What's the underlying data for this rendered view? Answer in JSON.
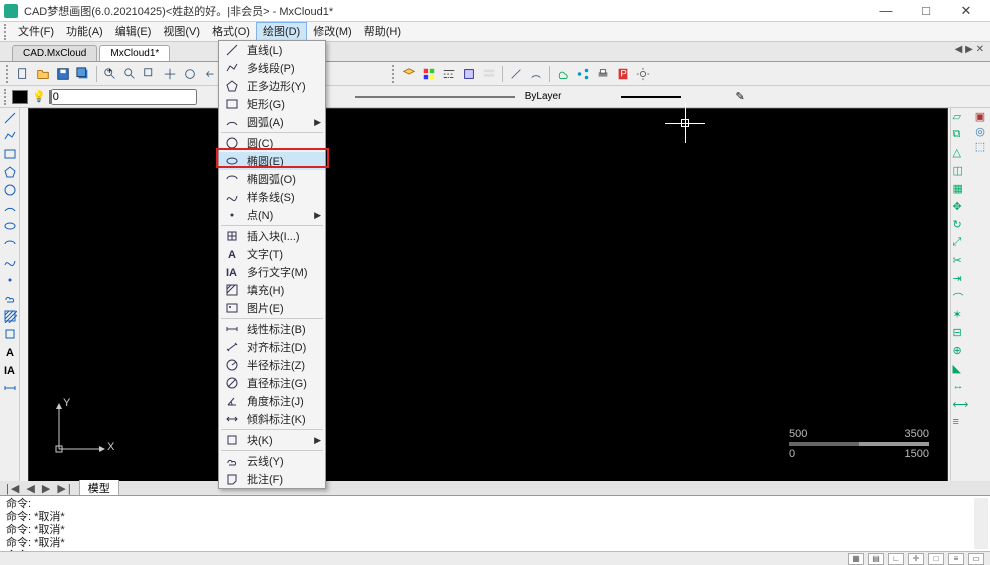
{
  "title": "CAD梦想画图(6.0.20210425)<姓赵的好。|非会员> - MxCloud1*",
  "menus": [
    "文件(F)",
    "功能(A)",
    "编辑(E)",
    "视图(V)",
    "格式(O)",
    "绘图(D)",
    "修改(M)",
    "帮助(H)"
  ],
  "active_menu_index": 5,
  "doctabs": {
    "tabs": [
      "CAD.MxCloud",
      "MxCloud1*"
    ],
    "active": 1
  },
  "layer": {
    "name": "0"
  },
  "prop": {
    "linetype": "ByLayer"
  },
  "draw_menu": [
    {
      "label": "直线(L)",
      "icon": "line"
    },
    {
      "label": "多线段(P)",
      "icon": "polyline"
    },
    {
      "label": "正多边形(Y)",
      "icon": "polygon"
    },
    {
      "label": "矩形(G)",
      "icon": "rect"
    },
    {
      "label": "圆弧(A)",
      "icon": "arc",
      "sub": true
    },
    {
      "sep": true
    },
    {
      "label": "圆(C)",
      "icon": "circle"
    },
    {
      "label": "椭圆(E)",
      "icon": "ellipse",
      "hl": true
    },
    {
      "label": "椭圆弧(O)",
      "icon": "ellipsearc"
    },
    {
      "label": "样条线(S)",
      "icon": "spline"
    },
    {
      "label": "点(N)",
      "icon": "point",
      "sub": true
    },
    {
      "sep": true
    },
    {
      "label": "插入块(I...)",
      "icon": "block"
    },
    {
      "label": "文字(T)",
      "icon": "text"
    },
    {
      "label": "多行文字(M)",
      "icon": "mtext"
    },
    {
      "label": "填充(H)",
      "icon": "hatch"
    },
    {
      "label": "图片(E)",
      "icon": "image"
    },
    {
      "sep": true
    },
    {
      "label": "线性标注(B)",
      "icon": "dimlin"
    },
    {
      "label": "对齐标注(D)",
      "icon": "dimalign"
    },
    {
      "label": "半径标注(Z)",
      "icon": "dimrad"
    },
    {
      "label": "直径标注(G)",
      "icon": "dimdia"
    },
    {
      "label": "角度标注(J)",
      "icon": "dimang"
    },
    {
      "label": "倾斜标注(K)",
      "icon": "dimobl"
    },
    {
      "sep": true
    },
    {
      "label": "块(K)",
      "icon": "blockdef",
      "sub": true
    },
    {
      "sep": true
    },
    {
      "label": "云线(Y)",
      "icon": "cloud"
    },
    {
      "label": "批注(F)",
      "icon": "note"
    }
  ],
  "model_tab": "模型",
  "cmd": {
    "lines": [
      "命令:",
      "命令: *取消*",
      "命令: *取消*",
      "命令: *取消*"
    ],
    "prompt": "命令:"
  },
  "scale": {
    "l1": "500",
    "l2": "1500",
    "r": "3500",
    "z": "0"
  },
  "ucs": {
    "x": "X",
    "y": "Y"
  }
}
